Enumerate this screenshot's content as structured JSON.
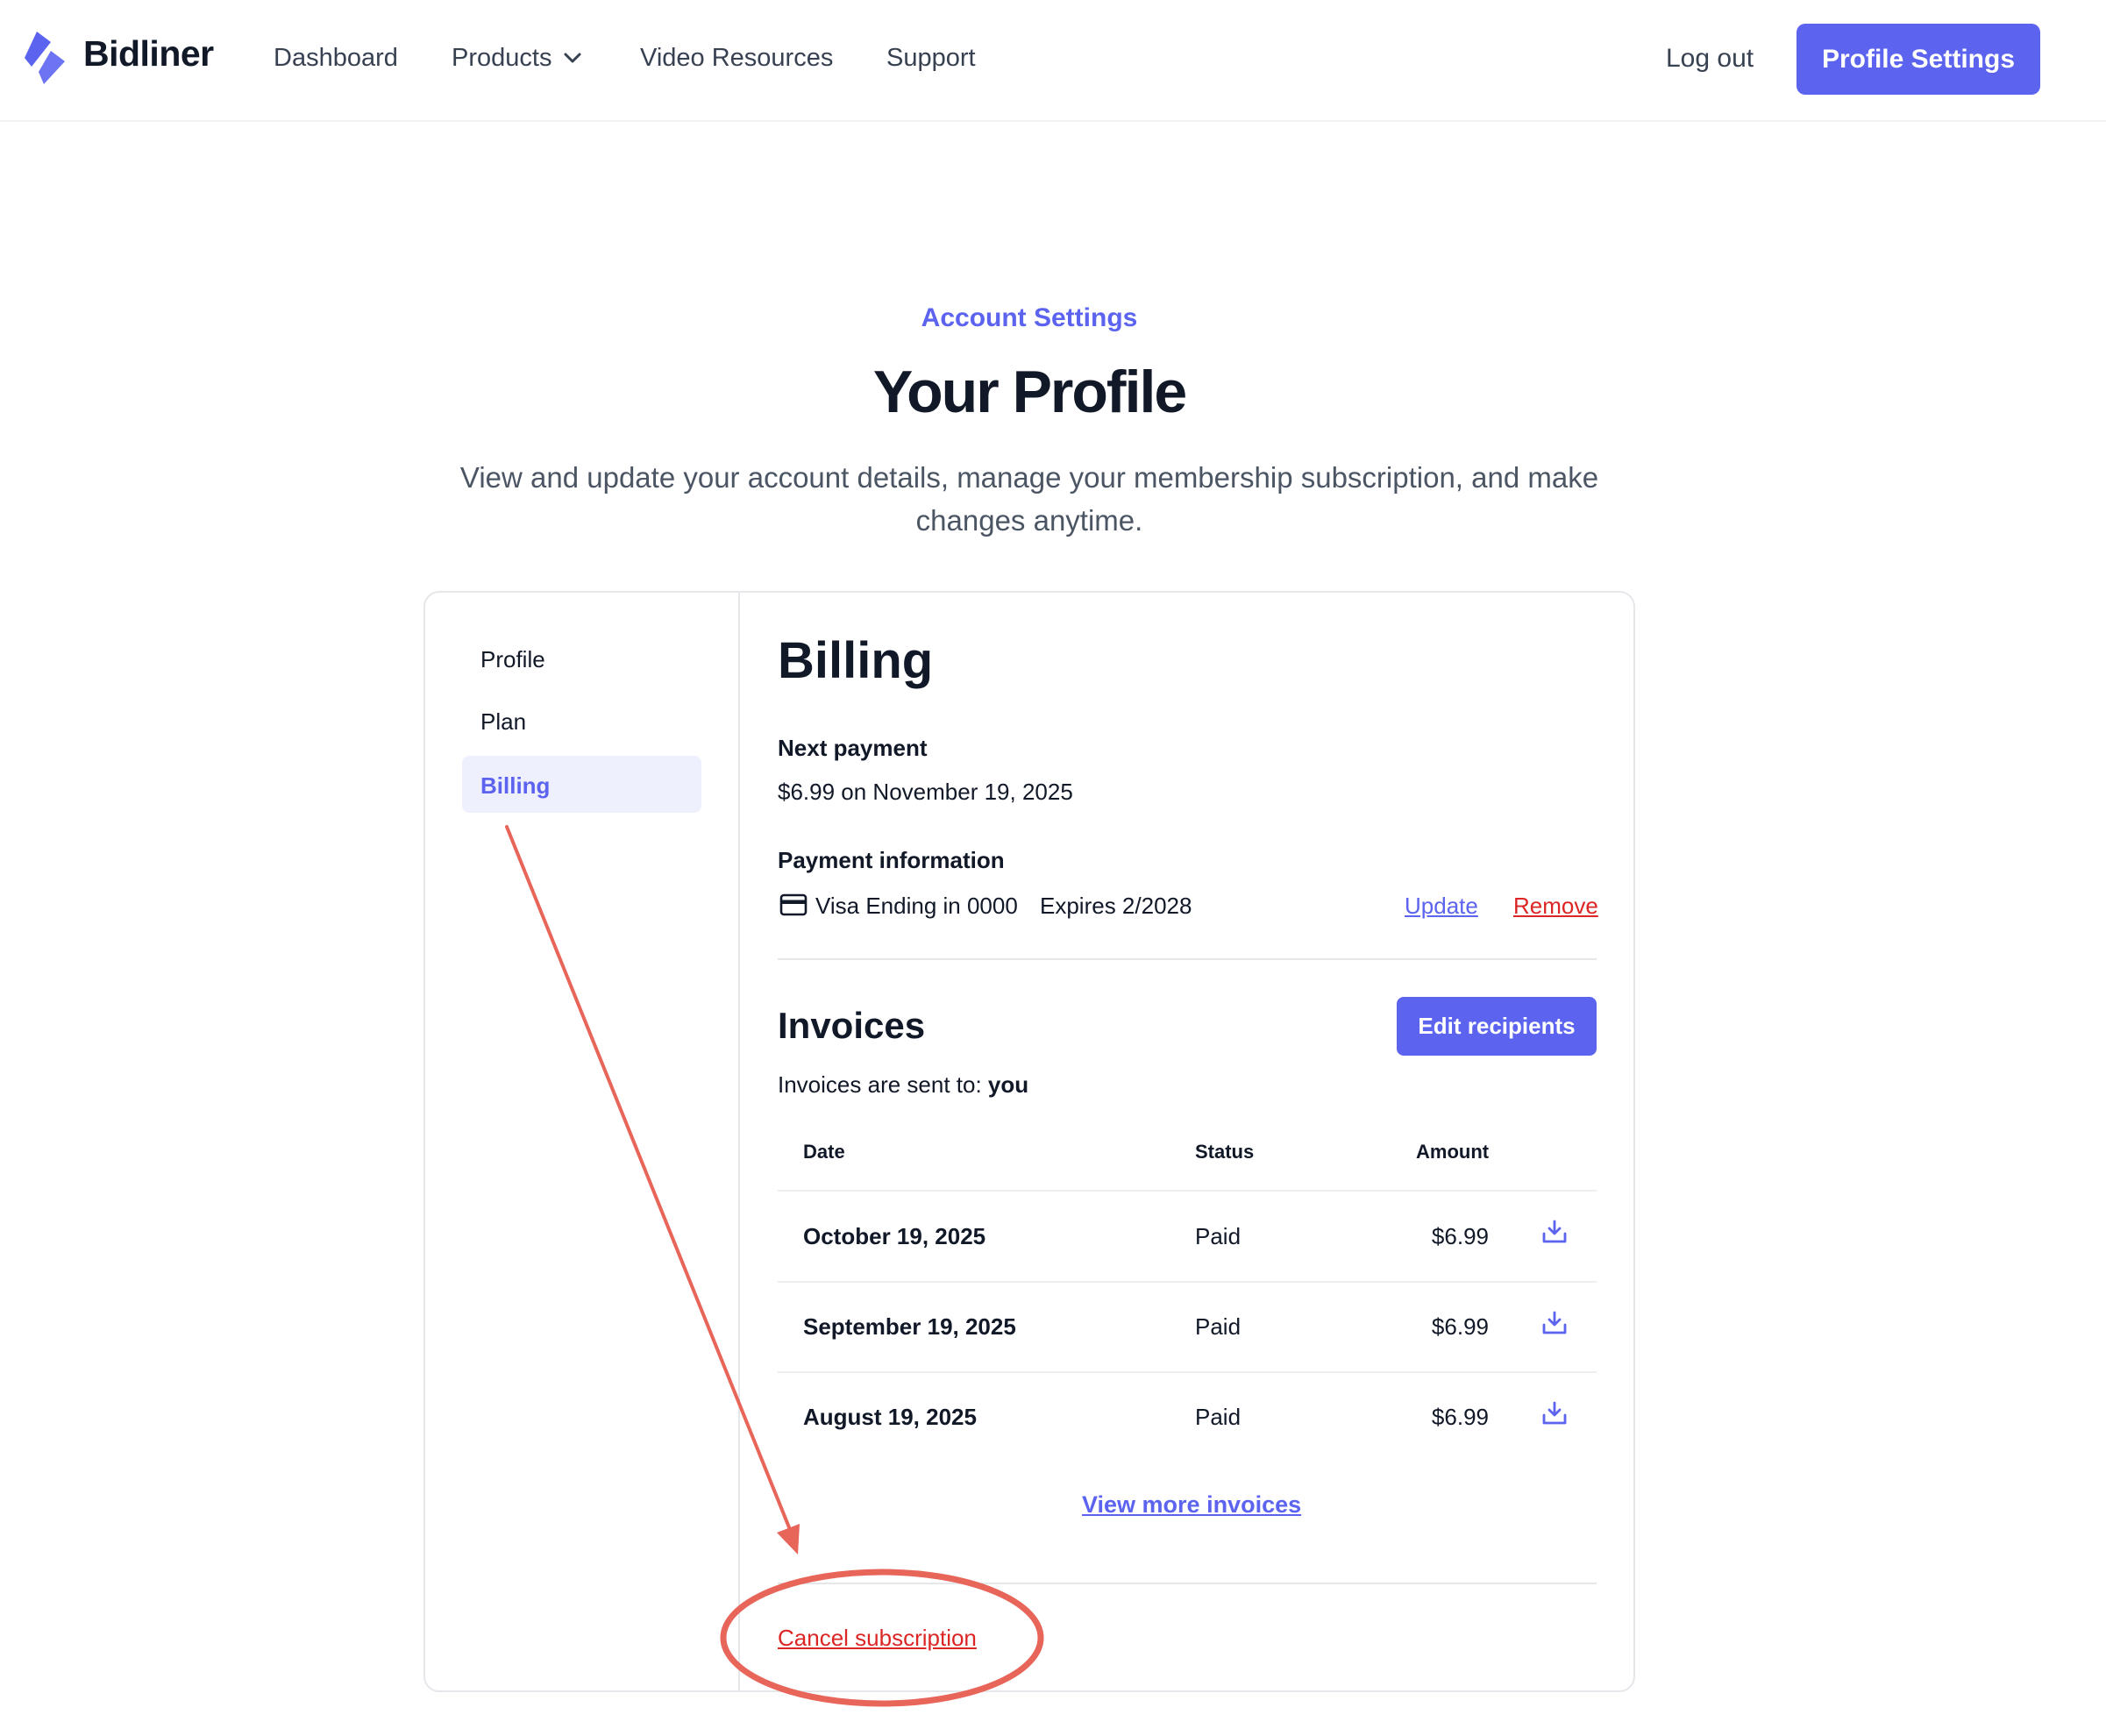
{
  "header": {
    "brand": "Bidliner",
    "nav": {
      "dashboard": "Dashboard",
      "products": "Products",
      "video_resources": "Video Resources",
      "support": "Support"
    },
    "log_out": "Log out",
    "profile_settings": "Profile Settings"
  },
  "hero": {
    "eyebrow": "Account Settings",
    "title": "Your Profile",
    "description": "View and update your account details, manage your membership subscription, and make changes anytime."
  },
  "sidebar": {
    "items": [
      {
        "label": "Profile"
      },
      {
        "label": "Plan"
      },
      {
        "label": "Billing",
        "active": true
      }
    ]
  },
  "billing": {
    "title": "Billing",
    "next_payment_label": "Next payment",
    "next_payment_value": "$6.99 on November 19, 2025",
    "payment_info_label": "Payment information",
    "card_text": "Visa Ending in 0000",
    "expires_text": "Expires 2/2028",
    "update_label": "Update",
    "remove_label": "Remove"
  },
  "invoices": {
    "title": "Invoices",
    "edit_recipients": "Edit recipients",
    "sent_to_prefix": "Invoices are sent to:",
    "sent_to_value": "you",
    "columns": {
      "date": "Date",
      "status": "Status",
      "amount": "Amount"
    },
    "rows": [
      {
        "date": "October 19, 2025",
        "status": "Paid",
        "amount": "$6.99"
      },
      {
        "date": "September 19, 2025",
        "status": "Paid",
        "amount": "$6.99"
      },
      {
        "date": "August 19, 2025",
        "status": "Paid",
        "amount": "$6.99"
      }
    ],
    "view_more": "View more invoices"
  },
  "cancel_subscription": "Cancel subscription",
  "colors": {
    "accent": "#5b63ef",
    "danger": "#dc2626",
    "annotation": "#e8655a",
    "active_bg": "#eef0fd"
  },
  "icons": {
    "logo": "bidliner-logo-icon",
    "products_chevron": "chevron-down-icon",
    "card": "credit-card-icon",
    "download": "download-icon"
  }
}
